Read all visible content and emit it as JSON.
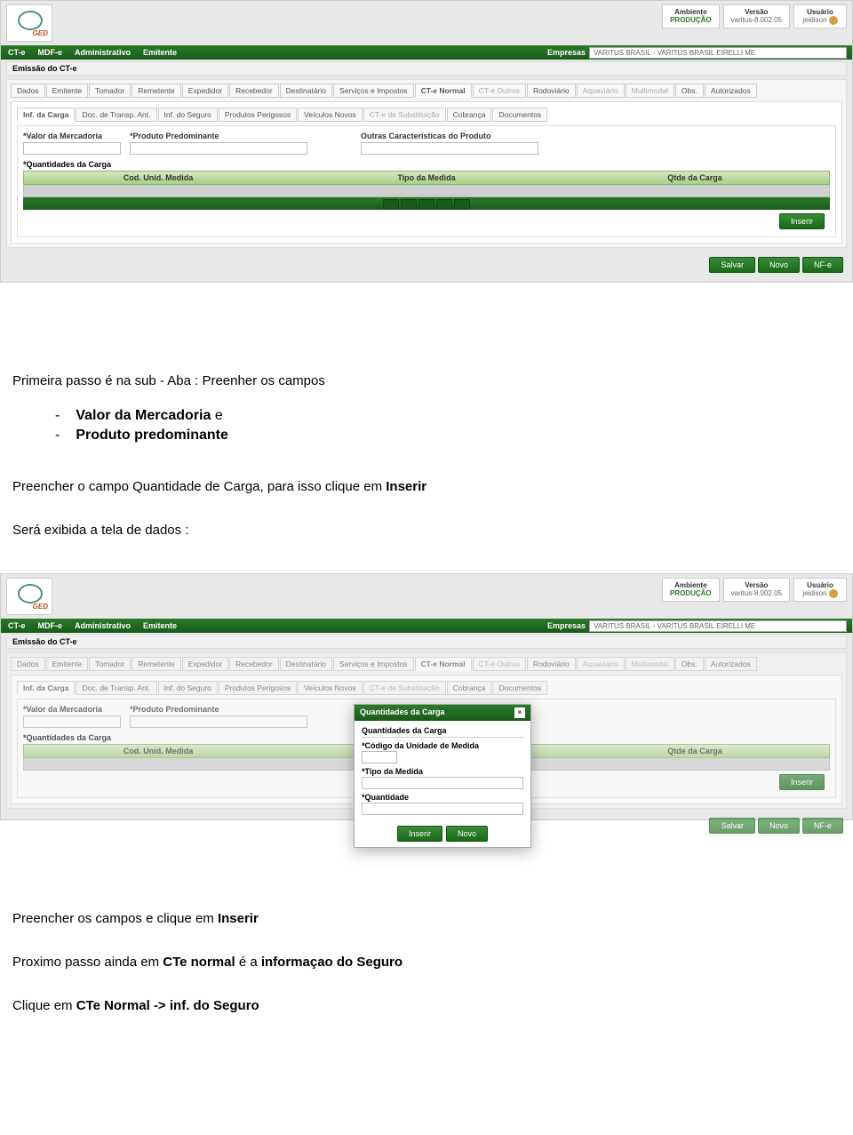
{
  "logo": {
    "text": "GED"
  },
  "header_boxes": {
    "ambiente_label": "Ambiente",
    "ambiente_value": "PRODUÇÃO",
    "versao_label": "Versão",
    "versao_value": "varitus-8.002.05",
    "usuario_label": "Usuário",
    "usuario_value": "jeidison"
  },
  "nav": {
    "items": [
      "CT-e",
      "MDF-e",
      "Administrativo",
      "Emitente"
    ],
    "empresas_label": "Empresas",
    "empresas_value": "VARITUS BRASIL - VARITUS BRASIL EIRELLI ME"
  },
  "crumb": "Emissão do CT-e",
  "tabs_main": [
    "Dados",
    "Emitente",
    "Tomador",
    "Remetente",
    "Expedidor",
    "Recebedor",
    "Destinatário",
    "Serviços e Impostos",
    "CT-e Normal",
    "CT-e Outros",
    "Rodoviário",
    "Aquaviário",
    "Multimodal",
    "Obs.",
    "Autorizados"
  ],
  "tabs_inner": [
    "Inf. da Carga",
    "Doc. de Transp. Ant.",
    "Inf. do Seguro",
    "Produtos Perigosos",
    "Veículos Novos",
    "CT-e de Substituição",
    "Cobrança",
    "Documentos"
  ],
  "fields": {
    "valor_mercadoria": "*Valor da Mercadoria",
    "produto_predominante": "*Produto Predominante",
    "outras_caract": "Outras Características do Produto",
    "quantidades": "*Quantidades da Carga"
  },
  "grid": {
    "cols": [
      "Cod. Unid. Medida",
      "Tipo da Medida",
      "Qtde da Carga"
    ]
  },
  "buttons": {
    "inserir": "Inserir",
    "salvar": "Salvar",
    "novo": "Novo",
    "nfe": "NF-e"
  },
  "doc": {
    "p1": "Primeira passo é na sub - Aba : Preenher os campos",
    "b1_label": "Valor da Mercadoria",
    "b1_suffix": " e",
    "b2_label": "Produto predominante",
    "p2a": "Preencher o campo Quantidade de Carga, para isso clique em ",
    "p2b": "Inserir",
    "p3": "Será exibida a tela de dados :",
    "p4a": "Preencher os campos e clique em ",
    "p4b": "Inserir",
    "p5a": "Proximo passo ainda em ",
    "p5b": "CTe normal",
    "p5c": " é a ",
    "p5d": "informaçao do Seguro",
    "p6a": "Clique em ",
    "p6b": "CTe Normal -> inf. do Seguro"
  },
  "modal": {
    "title": "Quantidades da Carga",
    "section": "Quantidades da Carga",
    "f1": "*Código da Unidade de Medida",
    "f2": "*Tipo da Medida",
    "f3": "*Quantidade",
    "btn_inserir": "Inserir",
    "btn_novo": "Novo",
    "close": "×"
  }
}
